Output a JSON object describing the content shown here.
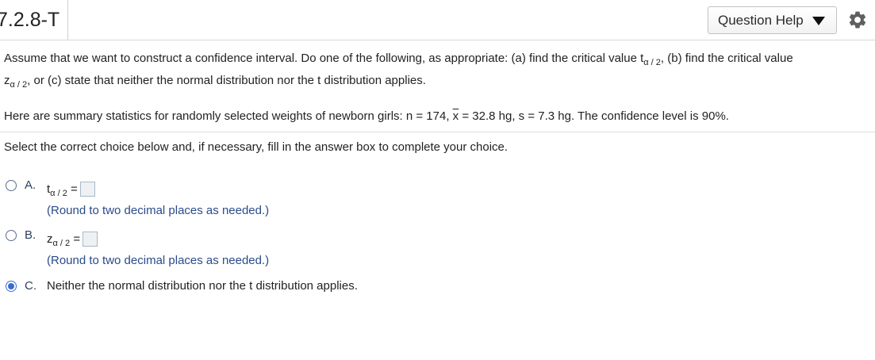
{
  "header": {
    "question_id": "7.2.8-T",
    "help_button_label": "Question Help",
    "caret_icon": "caret-down-icon",
    "settings_icon": "gear-icon"
  },
  "prompt": {
    "line1_a": "Assume that we want to construct a confidence interval. Do one of the following, as appropriate: (a) find the critical value t",
    "line1_sub": "α / 2",
    "line1_b": ", (b) find the critical value",
    "line2_a": "z",
    "line2_sub": "α / 2",
    "line2_b": ", or (c) state that neither the normal distribution nor the t distribution applies."
  },
  "stats": {
    "text_a": "Here are summary statistics for randomly selected weights of newborn girls: n = 174, ",
    "xbar": "x",
    "text_b": " = 32.8 hg, s = 7.3 hg. The confidence level is 90%."
  },
  "instruction": "Select the correct choice below and, if necessary, fill in the answer box to complete your choice.",
  "choices": [
    {
      "letter": "A.",
      "var": "t",
      "sub": "α / 2",
      "eq": "=",
      "hint": "(Round to two decimal places as needed.)",
      "answer": "",
      "selected": false
    },
    {
      "letter": "B.",
      "var": "z",
      "sub": "α / 2",
      "eq": "=",
      "hint": "(Round to two decimal places as needed.)",
      "answer": "",
      "selected": false
    },
    {
      "letter": "C.",
      "text": "Neither the normal distribution nor the t distribution applies.",
      "selected": true
    }
  ]
}
